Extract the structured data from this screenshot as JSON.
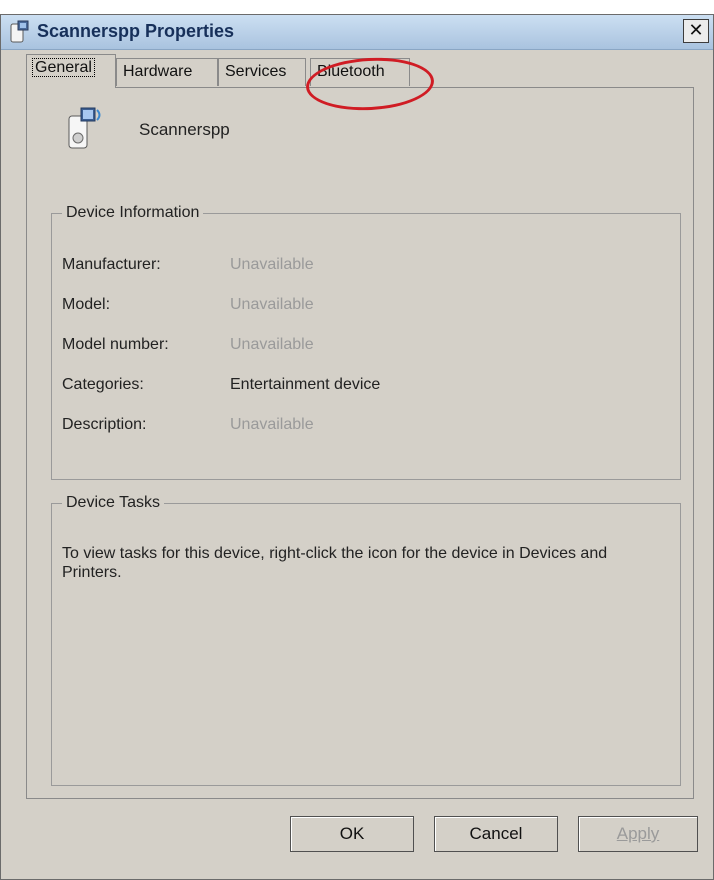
{
  "window": {
    "title": "Scannerspp Properties",
    "close_glyph": "✕",
    "icon": "bluetooth-device-icon"
  },
  "tabs": [
    {
      "label": "General",
      "active": true
    },
    {
      "label": "Hardware",
      "active": false
    },
    {
      "label": "Services",
      "active": false
    },
    {
      "label": "Bluetooth",
      "active": false
    }
  ],
  "device": {
    "name": "Scannerspp",
    "icon": "speaker-device-icon"
  },
  "device_info": {
    "legend": "Device Information",
    "rows": [
      {
        "label": "Manufacturer:",
        "value": "Unavailable"
      },
      {
        "label": "Model:",
        "value": "Unavailable"
      },
      {
        "label": "Model number:",
        "value": "Unavailable"
      },
      {
        "label": "Categories:",
        "value": "Entertainment device"
      },
      {
        "label": "Description:",
        "value": "Unavailable"
      }
    ]
  },
  "device_tasks": {
    "legend": "Device Tasks",
    "text": "To view tasks for this device, right-click the icon for the device in Devices and Printers."
  },
  "buttons": {
    "ok": "OK",
    "cancel": "Cancel",
    "apply": "Apply"
  },
  "colors": {
    "annotation": "#d01c24",
    "dialog_bg": "#d4d0c8",
    "unavailable_text": "#9a9a9a"
  }
}
